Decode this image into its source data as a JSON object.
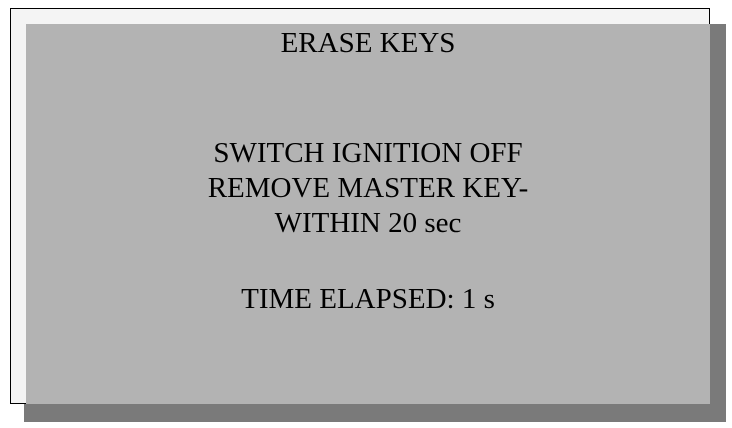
{
  "screen": {
    "title": "ERASE KEYS",
    "instructions": [
      "SWITCH IGNITION OFF",
      "REMOVE MASTER KEY-",
      "WITHIN 20 sec"
    ],
    "elapsed_label": "TIME ELAPSED: 1 s"
  },
  "colors": {
    "screen_background": "#b3b3b3",
    "text": "#000000",
    "shadow": "#7a7a7a"
  }
}
